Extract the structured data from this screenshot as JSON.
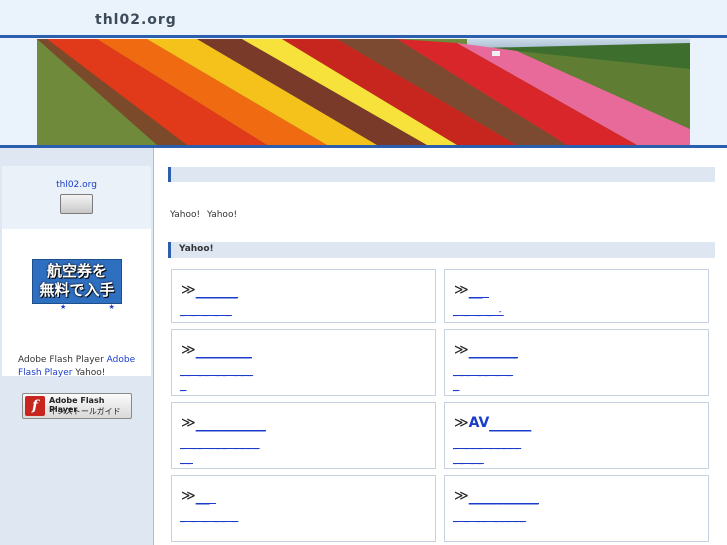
{
  "header": {
    "title": "thl02.org"
  },
  "banner": {
    "alt": "flower-field-banner"
  },
  "sidebar": {
    "link_label": "thl02.org",
    "ad": {
      "line1": "航空券を",
      "line2": "無料で入手"
    },
    "stars": "★ ★",
    "flash": {
      "text_prefix": "Adobe Flash Player ",
      "link_text": "Adobe Flash Player",
      "text_suffix": " Yahoo!",
      "badge_line1": "Adobe Flash Player",
      "badge_line2": "インストールガイド",
      "logo_glyph": "f"
    }
  },
  "main": {
    "intro": "Yahoo!  Yahoo!",
    "section_title": "Yahoo!",
    "cards": [
      {
        "prefix": "≫",
        "link": "______",
        "sub": "_ _ _ _ _"
      },
      {
        "prefix": "≫",
        "link": "__",
        "sub": "_ _ _ _ -"
      },
      {
        "prefix": "≫",
        "link": "________",
        "sub": "__ __ __ ___\n_"
      },
      {
        "prefix": "≫",
        "link": "_______",
        "sub": "___ __ _ _\n_"
      },
      {
        "prefix": "≫",
        "link": "__________",
        "sub": "_ __ ___ ____\n__"
      },
      {
        "prefix": "≫",
        "link": "AV",
        "link_tail": "______",
        "sub": "_ ___ _____\n__ __"
      },
      {
        "prefix": "≫",
        "link": "__",
        "sub": "_ _ _ __ _"
      },
      {
        "prefix": "≫",
        "link": "__________",
        "sub": "_ _ __ _____"
      }
    ]
  },
  "colors": {
    "accent": "#2b5fae",
    "link": "#1a3cc8",
    "sidebar_bg": "#dfe8f2",
    "header_bg": "#eaf3fb"
  }
}
